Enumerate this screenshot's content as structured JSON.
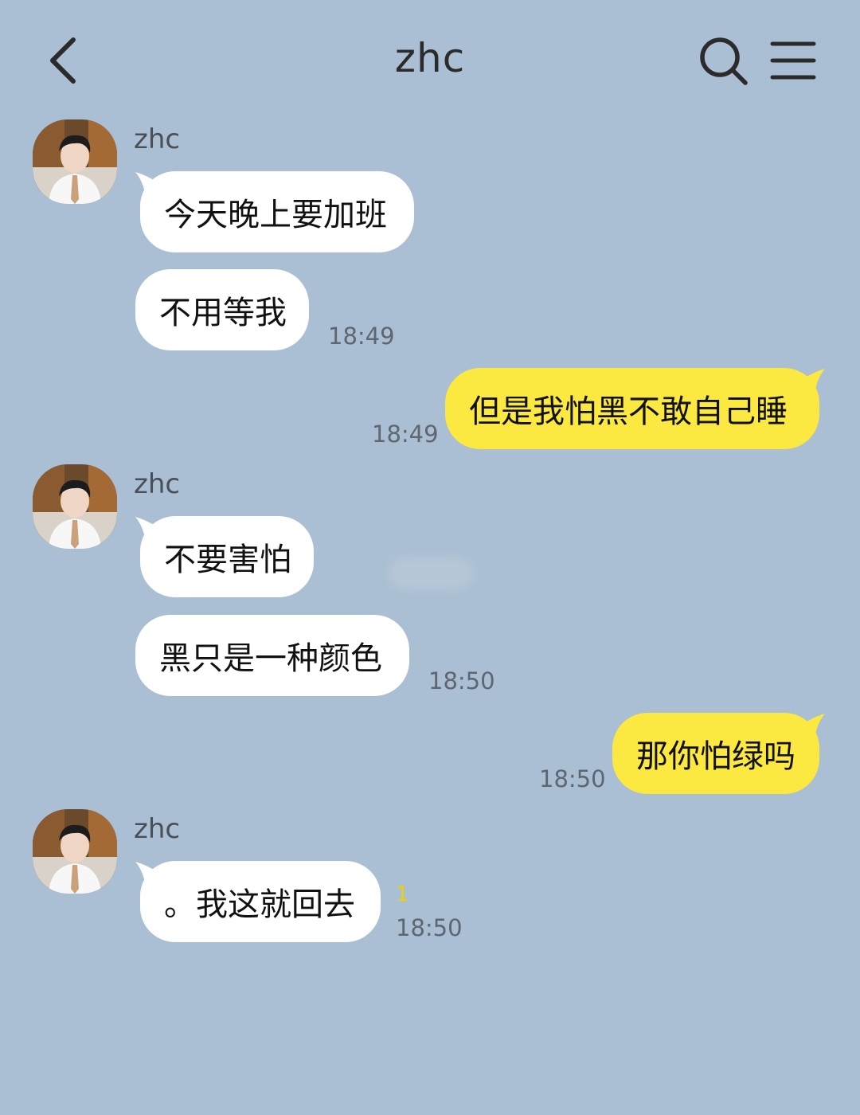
{
  "header": {
    "title": "zhc",
    "back_icon": "chevron-left-icon",
    "search_icon": "search-icon",
    "menu_icon": "menu-icon"
  },
  "colors": {
    "background": "#aabfd3",
    "incoming_bubble": "#ffffff",
    "outgoing_bubble": "#fbe840",
    "unread_count": "#f0d000"
  },
  "messages": [
    {
      "direction": "incoming",
      "sender": "zhc",
      "texts": [
        "今天晚上要加班",
        "不用等我"
      ],
      "time": "18:49"
    },
    {
      "direction": "outgoing",
      "text": "但是我怕黑不敢自己睡",
      "time": "18:49"
    },
    {
      "direction": "incoming",
      "sender": "zhc",
      "texts": [
        "不要害怕",
        "黑只是一种颜色"
      ],
      "time": "18:50"
    },
    {
      "direction": "outgoing",
      "text": "那你怕绿吗",
      "time": "18:50"
    },
    {
      "direction": "incoming",
      "sender": "zhc",
      "texts": [
        "。我这就回去"
      ],
      "unread": "1",
      "time": "18:50"
    }
  ]
}
